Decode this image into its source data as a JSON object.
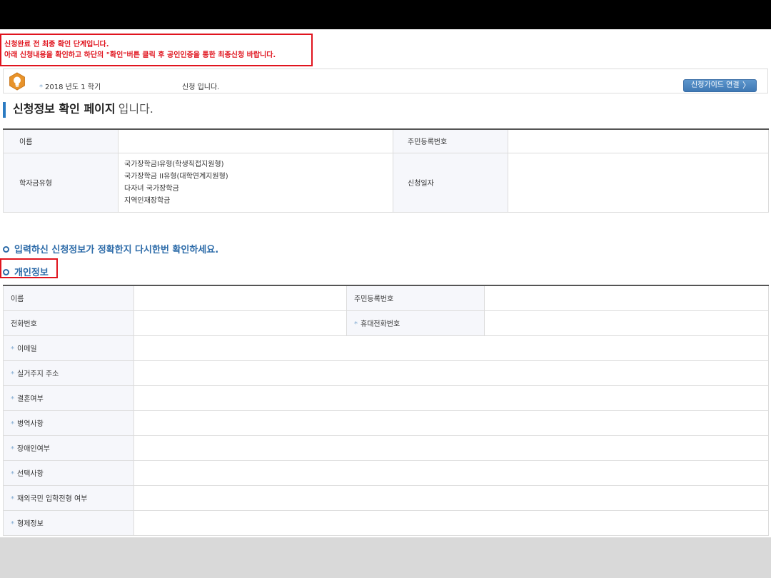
{
  "notice": {
    "line1": "신청완료 전 최종 확인 단계입니다.",
    "line2": "아래 신청내용을 확인하고 하단의 \"확인\"버튼 클릭 후 공인인증을 통한 최종신청 바랍니다."
  },
  "info_bar": {
    "semester_marker": "*",
    "semester": "2018 년도 1 학기",
    "apply_text": "신청 입니다.",
    "guide_button": "신청가이드 연결",
    "guide_chevron": "〉"
  },
  "page_title": {
    "bold": "신청정보 확인 페이지",
    "suffix": "입니다."
  },
  "summary_table": {
    "name_label": "이름",
    "resident_label": "주민등록번호",
    "scholarship_label": "학자금유형",
    "scholarship_types": [
      "국가장학금I유형(학생직접지원형)",
      "국가장학금 II유형(대학연계지원형)",
      "다자녀 국가장학금",
      "지역인재장학금"
    ],
    "apply_date_label": "신청일자"
  },
  "hint": "입력하신 신청정보가 정확한지 다시한번 확인하세요.",
  "personal": {
    "title": "개인정보",
    "required_marker": "*",
    "name_label": "이름",
    "resident_label": "주민등록번호",
    "phone_label": "전화번호",
    "mobile_label": "휴대전화번호",
    "email_label": "이메일",
    "address_label": "실거주지 주소",
    "marriage_label": "결혼여부",
    "military_label": "병역사항",
    "disability_label": "장애인여부",
    "optional_label": "선택사항",
    "overseas_label": "재외국민 입학전형 여부",
    "siblings_label": "형제정보"
  },
  "colors": {
    "notice_red": "#e0141e",
    "accent_blue": "#2b6aa8",
    "label_bg": "#f6f7fb"
  }
}
